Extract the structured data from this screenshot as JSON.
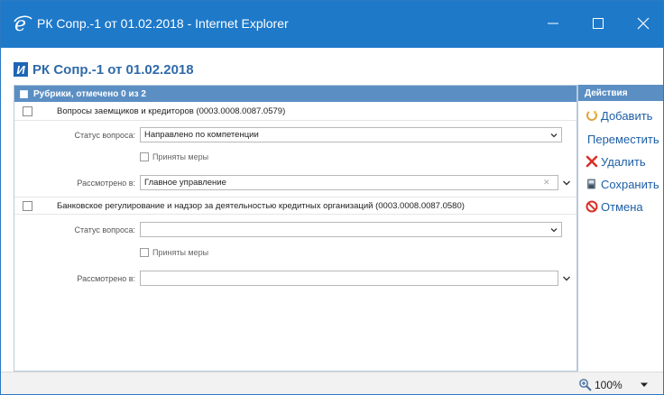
{
  "window": {
    "title": "РК Сопр.-1 от 01.02.2018 - Internet Explorer",
    "accent": "#1e79c9"
  },
  "document": {
    "badge": "И",
    "title": "РК Сопр.-1 от 01.02.2018"
  },
  "rubrics": {
    "header": "Рубрики, отмечено 0 из 2",
    "items": [
      {
        "name": "Вопросы заемщиков и кредиторов (0003.0008.0087.0579)",
        "status_label": "Статус вопроса:",
        "status_value": "Направлено по компетенции",
        "measures_label": "Приняты меры",
        "reviewed_label": "Рассмотрено в:",
        "reviewed_value": "Главное управление"
      },
      {
        "name": "Банковское регулирование и надзор за деятельностью кредитных организаций (0003.0008.0087.0580)",
        "status_label": "Статус вопроса:",
        "status_value": "",
        "measures_label": "Приняты меры",
        "reviewed_label": "Рассмотрено в:",
        "reviewed_value": ""
      }
    ]
  },
  "actions": {
    "header": "Действия",
    "add": "Добавить",
    "move": "Переместить",
    "delete": "Удалить",
    "save": "Сохранить",
    "cancel": "Отмена"
  },
  "status_bar": {
    "zoom": "100%"
  }
}
